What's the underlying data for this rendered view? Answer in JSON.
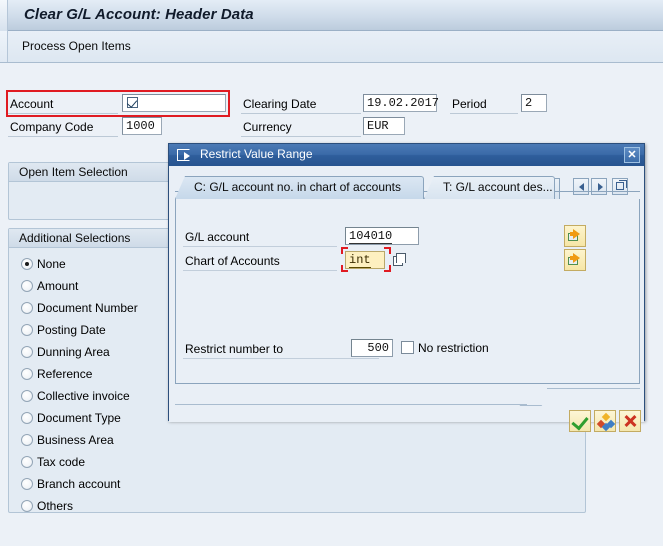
{
  "window": {
    "title": "Clear G/L Account: Header Data",
    "toolbar": {
      "process_open_items_label": "Process Open Items"
    }
  },
  "header_form": {
    "account": {
      "label": "Account",
      "value": "",
      "icon": "checkbox-checked-icon",
      "highlighted": true
    },
    "company_code": {
      "label": "Company Code",
      "value": "1000"
    },
    "clearing_date": {
      "label": "Clearing Date",
      "value": "19.02.2017"
    },
    "currency": {
      "label": "Currency",
      "value": "EUR"
    },
    "period": {
      "label": "Period",
      "value": "2"
    }
  },
  "groups": {
    "open_item_selection": {
      "title": "Open Item Selection"
    },
    "additional_selections": {
      "title": "Additional Selections",
      "selected": "None",
      "options": [
        {
          "label": "None",
          "selected": true
        },
        {
          "label": "Amount",
          "selected": false
        },
        {
          "label": "Document Number",
          "selected": false
        },
        {
          "label": "Posting Date",
          "selected": false
        },
        {
          "label": "Dunning Area",
          "selected": false
        },
        {
          "label": "Reference",
          "selected": false
        },
        {
          "label": "Collective invoice",
          "selected": false
        },
        {
          "label": "Document Type",
          "selected": false
        },
        {
          "label": "Business Area",
          "selected": false
        },
        {
          "label": "Tax code",
          "selected": false
        },
        {
          "label": "Branch account",
          "selected": false
        },
        {
          "label": "Others",
          "selected": false
        }
      ]
    }
  },
  "dialog": {
    "title": "Restrict Value Range",
    "title_icon": "export-box-icon",
    "close_label": "✕",
    "tabs": [
      {
        "label": "C: G/L account no. in chart of accounts",
        "active": true
      },
      {
        "label": "T: G/L account des...",
        "active": false
      }
    ],
    "tab_nav": {
      "prev_icon": "chevron-left-icon",
      "next_icon": "chevron-right-icon",
      "list_icon": "tab-list-icon"
    },
    "fields": {
      "gl_account": {
        "label": "G/L account",
        "value": "104010"
      },
      "chart_of_accounts": {
        "label": "Chart of Accounts",
        "value": "int",
        "focused": true,
        "multi_select_icon": "multiple-selection-icon"
      },
      "restrict_number_to": {
        "label": "Restrict number to",
        "value": "500"
      },
      "no_restriction": {
        "label": "No restriction",
        "checked": false
      }
    },
    "side_buttons": [
      {
        "name": "multiple-selection-gl-account",
        "icon": "folder-arrow-icon"
      },
      {
        "name": "multiple-selection-chart-of-accounts",
        "icon": "folder-arrow-icon"
      }
    ],
    "footer_buttons": [
      {
        "name": "continue-button",
        "icon": "green-check-icon"
      },
      {
        "name": "multiple-selection-button",
        "icon": "multi-color-diamond-icon"
      },
      {
        "name": "cancel-button",
        "icon": "red-x-icon"
      }
    ]
  },
  "colors": {
    "accent_blue": "#2f5e9c",
    "focus_red": "#e01b22",
    "highlight_yellow": "#fdf0c0",
    "ok_green": "#2f9e2f",
    "cancel_red": "#cc3322",
    "canvas": "#ecf1f7"
  }
}
